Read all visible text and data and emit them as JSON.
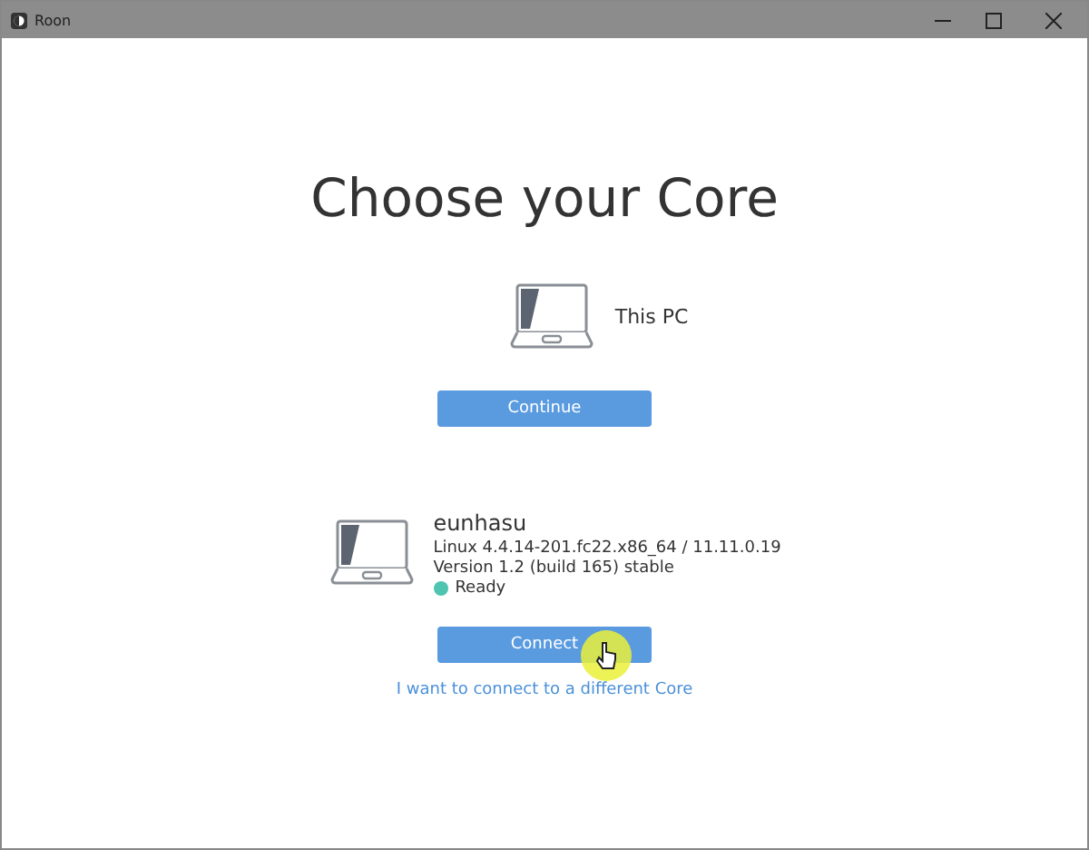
{
  "window": {
    "title": "Roon"
  },
  "heading": "Choose your Core",
  "this_pc": {
    "label": "This PC",
    "button": "Continue"
  },
  "cores": [
    {
      "name": "eunhasu",
      "system": "Linux 4.4.14-201.fc22.x86_64 / 11.11.0.19",
      "version": "Version 1.2 (build 165) stable",
      "status": "Ready",
      "color": "#4fc4b0",
      "button": "Connect"
    }
  ],
  "link": "I want to connect to a different Core"
}
